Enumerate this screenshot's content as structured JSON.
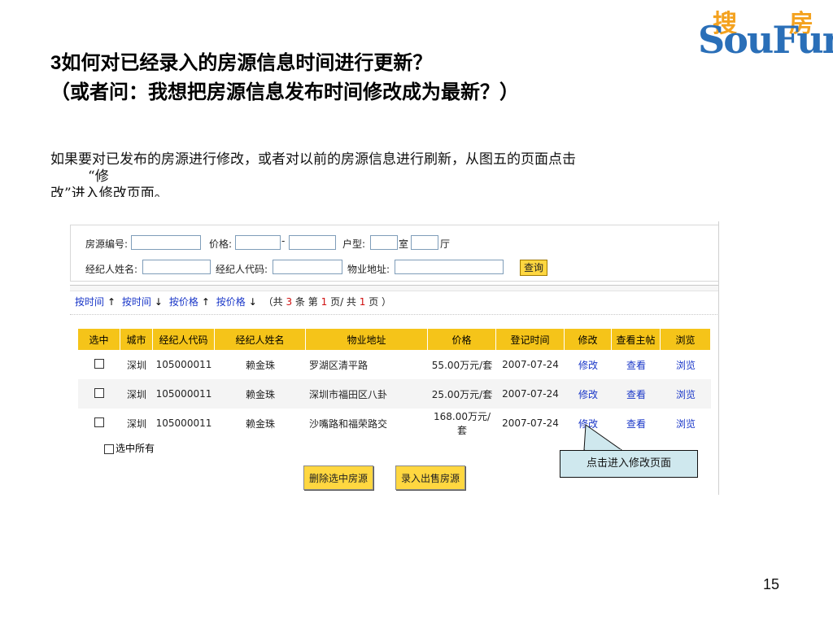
{
  "logo": {
    "cn_left": "搜",
    "cn_right": "房",
    "en": "SouFun"
  },
  "title": {
    "number": "3",
    "line1": "如何对已经录入的房源信息时间进行更新？",
    "line2": "（或者问：我想把房源信息发布时间修改成为最新？）"
  },
  "paragraph": {
    "line1": "如果要对已发布的房源进行修改，或者对以前的房源信息进行刷新，从图五的页面点击",
    "line2": "“修",
    "line3": "改”进入修改页面。"
  },
  "search": {
    "house_no_label": "房源编号:",
    "price_label": "价格:",
    "price_dash": "-",
    "layout_label": "户型:",
    "room_label": "室",
    "hall_label": "厅",
    "agent_name_label": "经纪人姓名:",
    "agent_code_label": "经纪人代码:",
    "address_label": "物业地址:",
    "query_button": "查询"
  },
  "sortbar": {
    "by_time_up": "按时间",
    "by_time_down": "按时间",
    "by_price_up": "按价格",
    "by_price_down": "按价格",
    "up_arrow": "↑",
    "down_arrow": "↓",
    "summary_open": "（共",
    "total_count": "3",
    "unit": "条 第",
    "current_page": "1",
    "page_sep": "页/ 共",
    "total_pages": "1",
    "summary_close": "页 ）"
  },
  "table": {
    "headers": [
      "选中",
      "城市",
      "经纪人代码",
      "经纪人姓名",
      "物业地址",
      "价格",
      "登记时间",
      "修改",
      "查看主帖",
      "浏览"
    ],
    "rows": [
      {
        "city": "深圳",
        "code": "105000011",
        "name": "赖金珠",
        "address": "罗湖区清平路",
        "price": "55.00万元/套",
        "date": "2007-07-24",
        "edit": "修改",
        "view": "查看",
        "browse": "浏览"
      },
      {
        "city": "深圳",
        "code": "105000011",
        "name": "赖金珠",
        "address": "深圳市福田区八卦",
        "price": "25.00万元/套",
        "date": "2007-07-24",
        "edit": "修改",
        "view": "查看",
        "browse": "浏览"
      },
      {
        "city": "深圳",
        "code": "105000011",
        "name": "赖金珠",
        "address": "沙嘴路和福荣路交",
        "price": "168.00万元/套",
        "date": "2007-07-24",
        "edit": "修改",
        "view": "查看",
        "browse": "浏览"
      }
    ]
  },
  "select_all": "选中所有",
  "buttons": {
    "delete_selected": "删除选中房源",
    "add_listing": "录入出售房源"
  },
  "callout": "点击进入修改页面",
  "page_number": "15"
}
